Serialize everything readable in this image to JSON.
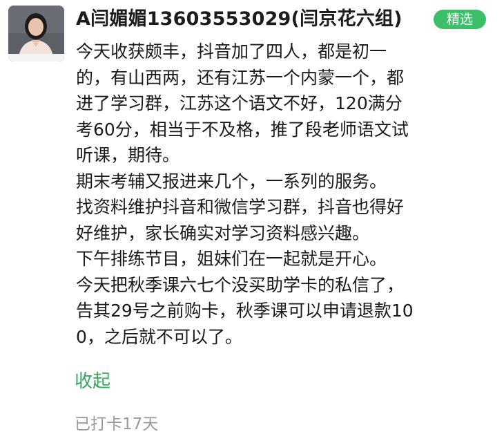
{
  "author": {
    "name": "A闫媚媚13603553029(闫京花六组)"
  },
  "badge": {
    "label": "精选",
    "color": "#3cbf68"
  },
  "post": {
    "lines": [
      "今天收获颇丰，抖音加了四人，都是初一",
      "的，有山西两，还有江苏一个内蒙一个，都",
      "进了学习群，江苏这个语文不好，120满分",
      "考60分，相当于不及格，推了段老师语文试",
      "听课，期待。",
      "期末考辅又报进来几个，一系列的服务。",
      "找资料维护抖音和微信学习群，抖音也得好",
      "好维护，家长确实对学习资料感兴趣。",
      "下午排练节目，姐妹们在一起就是开心。",
      "今天把秋季课六七个没买助学卡的私信了，",
      "告其29号之前购卡，秋季课可以申请退款10",
      "0，之后就不可以了。"
    ]
  },
  "actions": {
    "collapse_label": "收起",
    "link_color": "#3aa55c"
  },
  "footer": {
    "checkin_text": "已打卡17天"
  }
}
